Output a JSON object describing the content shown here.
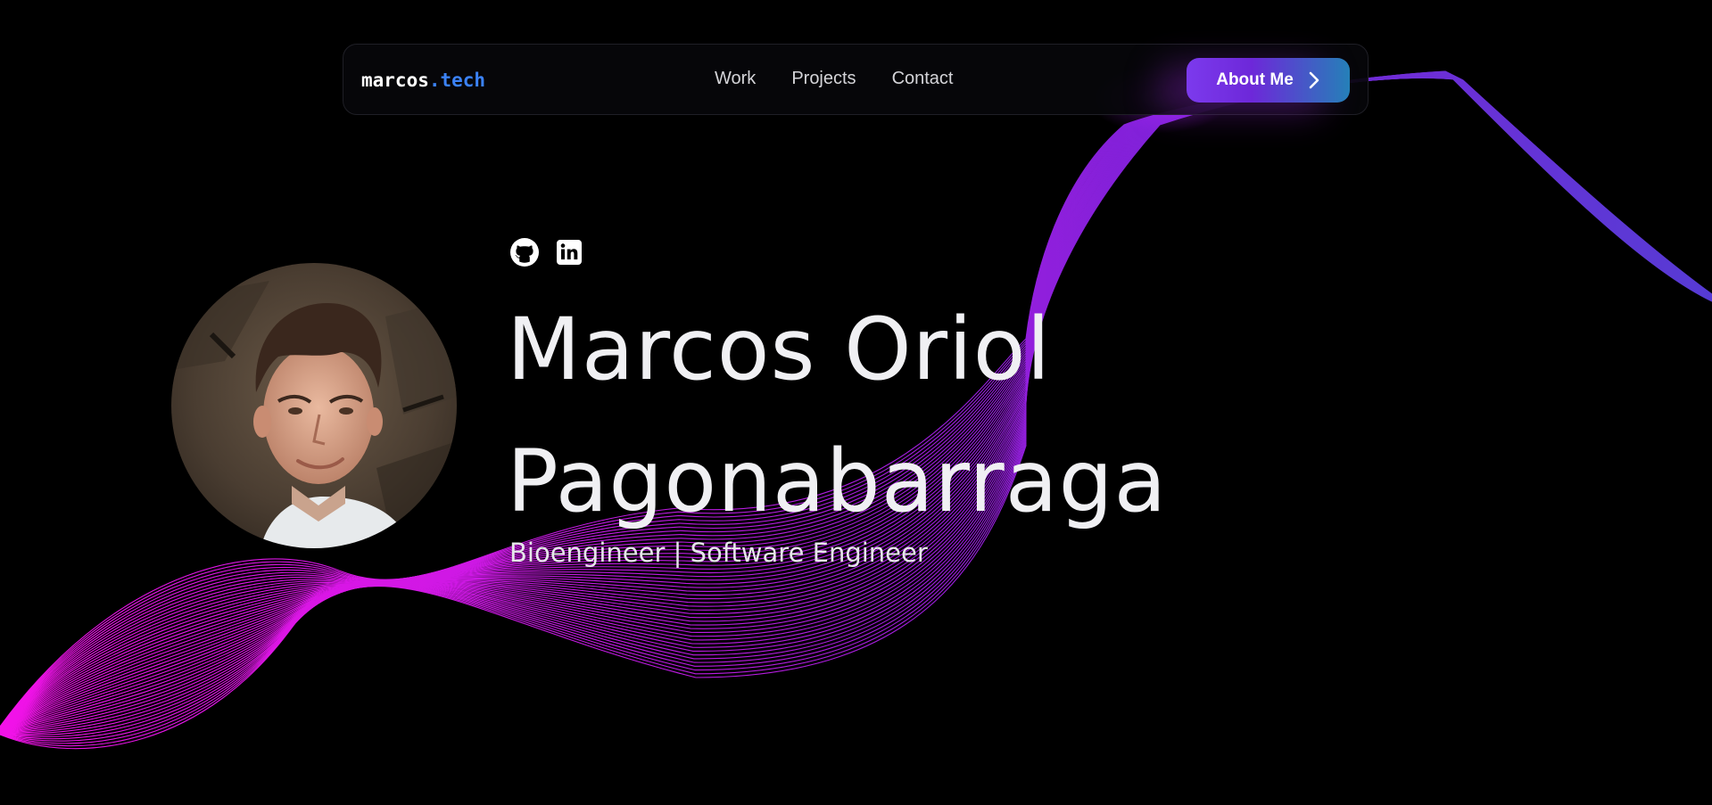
{
  "colors": {
    "background": "#000000",
    "accent_blue": "#3b82f6",
    "wave_magenta": "#e81cff",
    "wave_violet": "#7b2cf0",
    "button_gradient_start": "#7c3aed",
    "button_gradient_end": "#2580b8"
  },
  "navbar": {
    "logo": {
      "name": "marcos",
      "accent": ".tech"
    },
    "links": [
      "Work",
      "Projects",
      "Contact"
    ],
    "cta": {
      "label": "About Me",
      "icon": "chevron-right-icon"
    }
  },
  "hero": {
    "social_icons": [
      "github-icon",
      "linkedin-icon"
    ],
    "avatar": "profile-photo",
    "name_line1": "Marcos Oriol",
    "name_line2": "Pagonabarraga",
    "tagline": "Bioengineer | Software Engineer"
  }
}
